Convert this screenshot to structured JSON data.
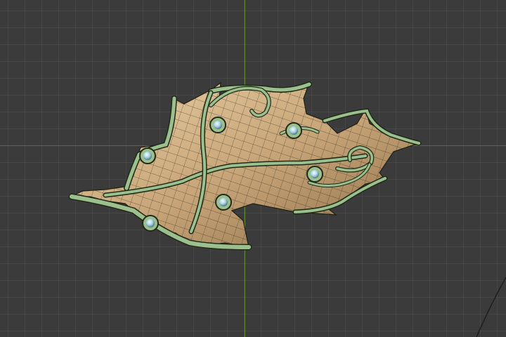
{
  "viewport": {
    "background": "#3b3b3b",
    "grid_color": "#4a4a4a",
    "axis_x_color": "#9a4a46",
    "axis_y_color": "#5f8a3a"
  },
  "model": {
    "name_icon": "leaf-ornament-mesh",
    "metal_color": "#c8a878",
    "vine_color": "#9cbf8e",
    "gem_color": "#b8dbe8",
    "wire_color": "#2a2a1e"
  }
}
